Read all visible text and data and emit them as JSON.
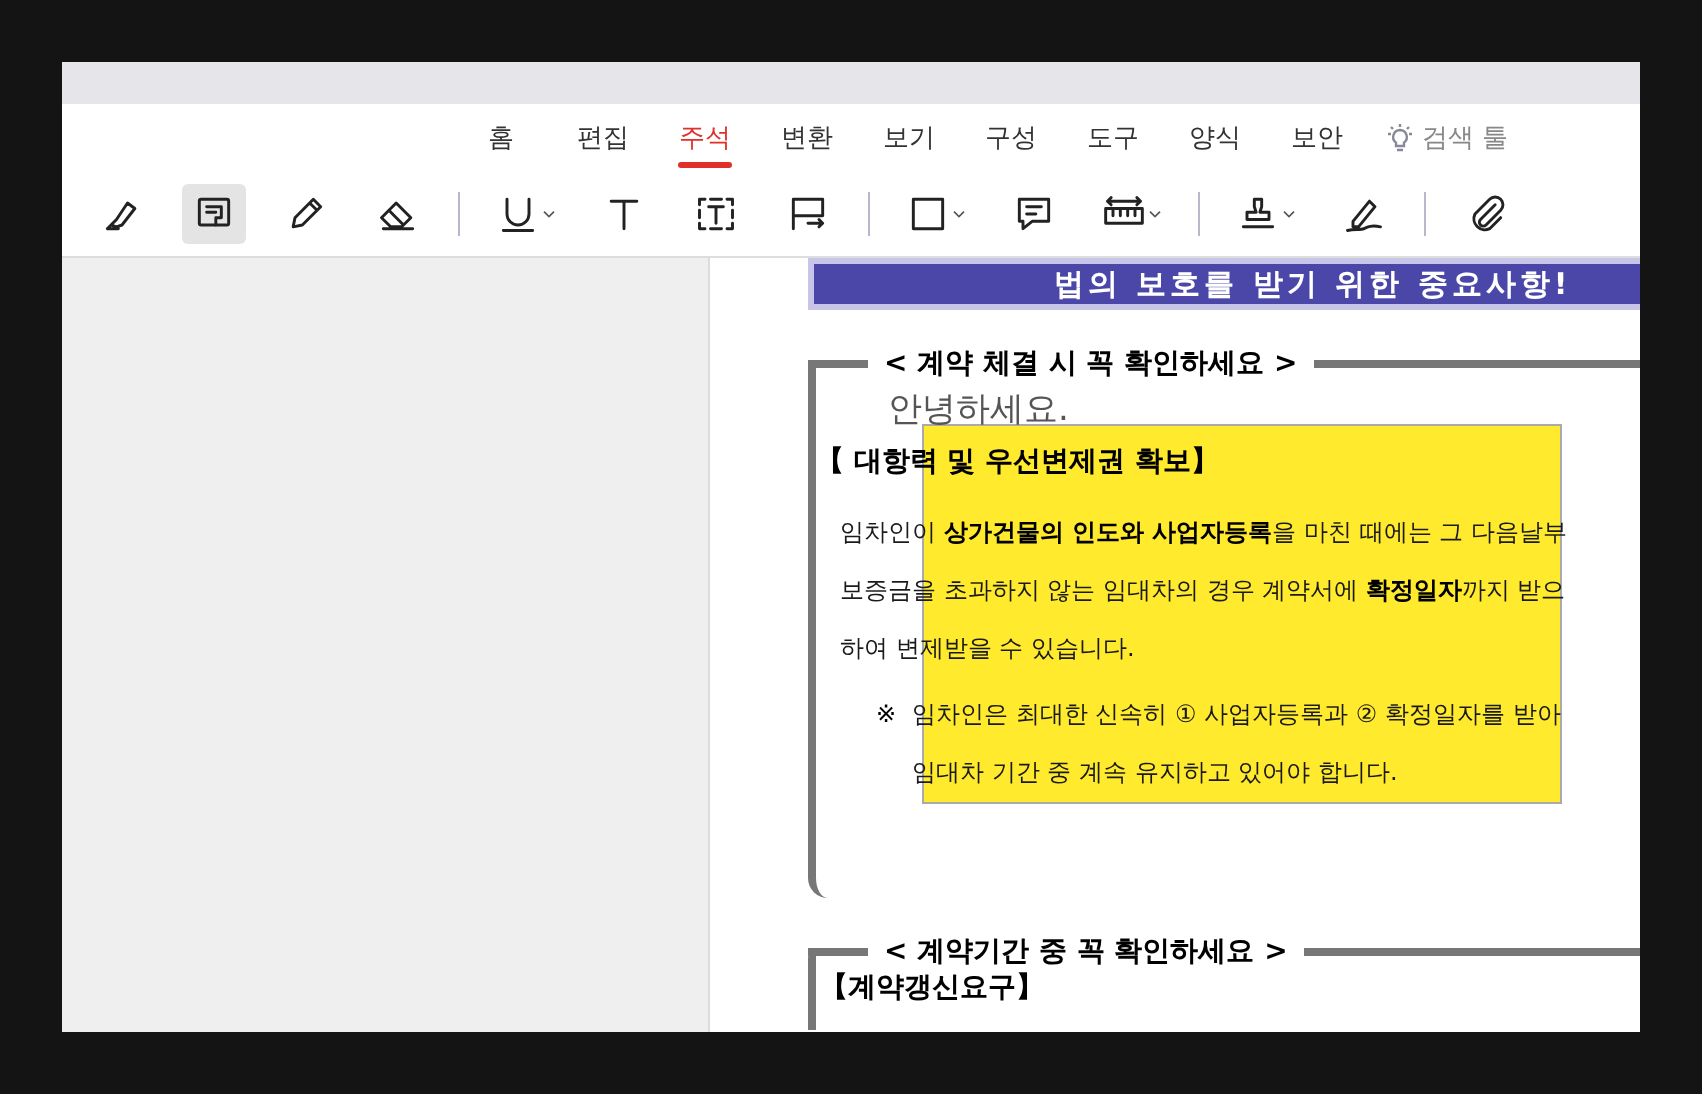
{
  "tabs": [
    {
      "label": "홈",
      "selected": false
    },
    {
      "label": "편집",
      "selected": false
    },
    {
      "label": "주석",
      "selected": true
    },
    {
      "label": "변환",
      "selected": false
    },
    {
      "label": "보기",
      "selected": false
    },
    {
      "label": "구성",
      "selected": false
    },
    {
      "label": "도구",
      "selected": false
    },
    {
      "label": "양식",
      "selected": false
    },
    {
      "label": "보안",
      "selected": false
    }
  ],
  "search_tool": {
    "label": "검색 툴"
  },
  "tools": [
    {
      "selected": false
    },
    {
      "selected": true
    },
    {
      "selected": false
    },
    {
      "selected": false
    },
    {
      "selected": false
    },
    {
      "selected": false
    },
    {
      "selected": false
    },
    {
      "selected": false
    },
    {
      "selected": false
    },
    {
      "selected": false
    },
    {
      "selected": false
    },
    {
      "selected": false
    },
    {
      "selected": false
    },
    {
      "selected": false
    }
  ],
  "document": {
    "banner": "법의 보호를 받기 위한 중요사항!",
    "section_1_heading": "< 계약 체결 시 꼭 확인하세요 >",
    "typed_text": "안녕하세요.",
    "subheading": "【 대항력 및 우선변제권 확보】",
    "paragraph": [
      "임차인이 **상가건물의 인도와 사업자등록**을 마친 때에는 그 다음날부",
      "보증금을 초과하지 않는 임대차의 경우 계약서에 **확정일자**까지 받으",
      "하여 변제받을 수 있습니다."
    ],
    "note_mark": "※",
    "note": [
      "임차인은 최대한 신속히 ① 사업자등록과 ② 확정일자를 받아",
      "임대차 기간 중 계속 유지하고 있어야 합니다."
    ],
    "section_2_heading": "< 계약기간 중 꼭 확인하세요 >",
    "subheading_2": "【계약갱신요구】"
  }
}
